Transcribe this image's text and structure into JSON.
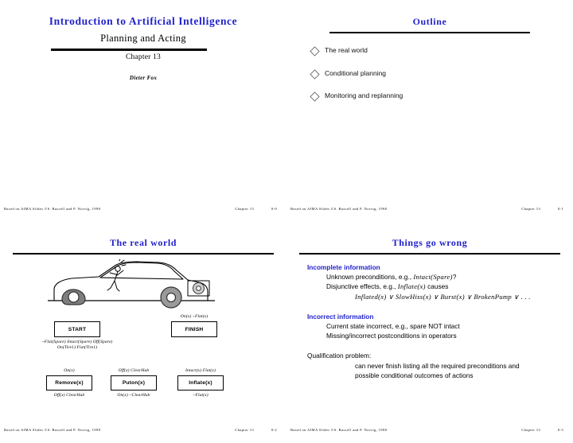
{
  "deck": {
    "slides": [
      {
        "id": "title",
        "main_title": "Introduction to Artificial Intelligence",
        "subtitle": "Planning and Acting",
        "chapter": "Chapter 13",
        "author": "Dieter Fox",
        "footer": {
          "credit": "Based on AIMA Slides ©S. Russell and P. Norvig, 1998",
          "chapter": "Chapter 13",
          "number": "0-0"
        }
      },
      {
        "id": "outline",
        "heading": "Outline",
        "bullets": [
          "The real world",
          "Conditional planning",
          "Monitoring and replanning"
        ],
        "footer": {
          "credit": "Based on AIMA Slides ©S. Russell and P. Norvig, 1998",
          "chapter": "Chapter 13",
          "number": "0-1"
        }
      },
      {
        "id": "real-world",
        "heading": "The real world",
        "plan": {
          "start": {
            "label": "START",
            "effects_line1": "~Flat(Spare) Intact(Spare) Off(Spare)",
            "effects_line2": "On(Tire1) Flat(Tire1)"
          },
          "finish": {
            "label": "FINISH",
            "preconditions": "On(x)  ~Flat(x)"
          },
          "actions": [
            {
              "label": "Remove(x)",
              "preconditions": "On(x)",
              "effects": "Off(x)  ClearHub"
            },
            {
              "label": "Puton(x)",
              "preconditions": "Off(x)  ClearHub",
              "effects": "On(x)  ~ClearHub"
            },
            {
              "label": "Inflate(x)",
              "preconditions": "Intact(x)  Flat(x)",
              "effects": "~Flat(x)"
            }
          ]
        },
        "footer": {
          "credit": "Based on AIMA Slides ©S. Russell and P. Norvig, 1998",
          "chapter": "Chapter 13",
          "number": "0-2"
        }
      },
      {
        "id": "things-go-wrong",
        "heading": "Things go wrong",
        "sections": [
          {
            "title": "Incomplete information",
            "lines": [
              "Unknown preconditions, e.g., ",
              "Disjunctive effects, e.g., "
            ],
            "math": {
              "intact_spare": "Intact(Spare)",
              "question": "?",
              "inflate_x": "Inflate(x)",
              "causes": " causes",
              "disjunction": "Inflated(x) ∨ SlowHiss(x) ∨ Burst(x) ∨ BrokenPump ∨ . . ."
            }
          },
          {
            "title": "Incorrect information",
            "lines": [
              "Current state incorrect, e.g., spare NOT intact",
              "Missing/incorrect postconditions in operators"
            ]
          },
          {
            "title": "Qualification problem:",
            "lines": [
              "can never finish listing all the required preconditions and",
              "possible conditional outcomes of actions"
            ]
          }
        ],
        "footer": {
          "credit": "Based on AIMA Slides ©S. Russell and P. Norvig, 1998",
          "chapter": "Chapter 13",
          "number": "0-3"
        }
      }
    ]
  },
  "colors": {
    "heading_blue": "#2222cc",
    "rule_black": "#000000",
    "tire_gray": "#9a9a9a"
  }
}
